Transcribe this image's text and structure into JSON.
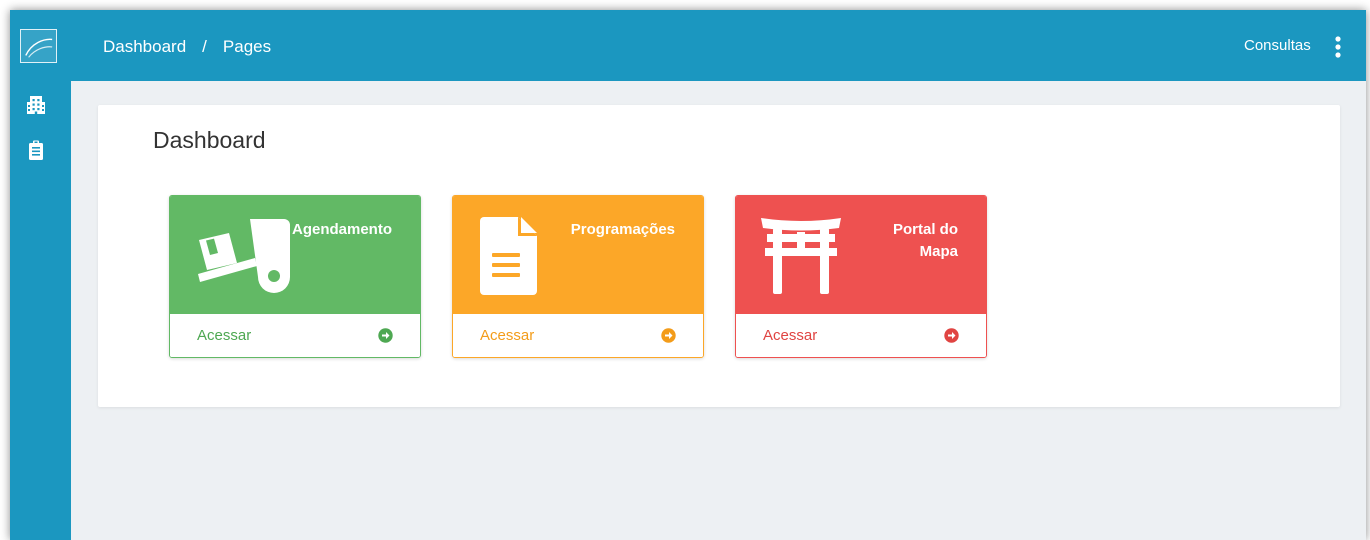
{
  "header": {
    "breadcrumb": [
      "Dashboard",
      "Pages"
    ],
    "breadcrumb_separator": "/",
    "right_link": "Consultas",
    "menu_icon": "kebab-menu-icon"
  },
  "sidebar": {
    "logo_icon": "brand-logo-icon",
    "items": [
      {
        "icon": "building-icon"
      },
      {
        "icon": "clipboard-icon"
      }
    ]
  },
  "main": {
    "title": "Dashboard",
    "cards": [
      {
        "label_lines": [
          "Agendamento"
        ],
        "link": "Acessar",
        "icon": "dolly-icon",
        "color": "#62b965"
      },
      {
        "label_lines": [
          "Programações"
        ],
        "link": "Acessar",
        "icon": "file-document-icon",
        "color": "#fca728"
      },
      {
        "label_lines": [
          "Portal do",
          "Mapa"
        ],
        "link": "Acessar",
        "icon": "torii-gate-icon",
        "color": "#ee5150"
      }
    ]
  },
  "colors": {
    "primary": "#1b97c0",
    "background": "#edf0f3",
    "green": "#62b965",
    "orange": "#fca728",
    "red": "#ee5150"
  }
}
